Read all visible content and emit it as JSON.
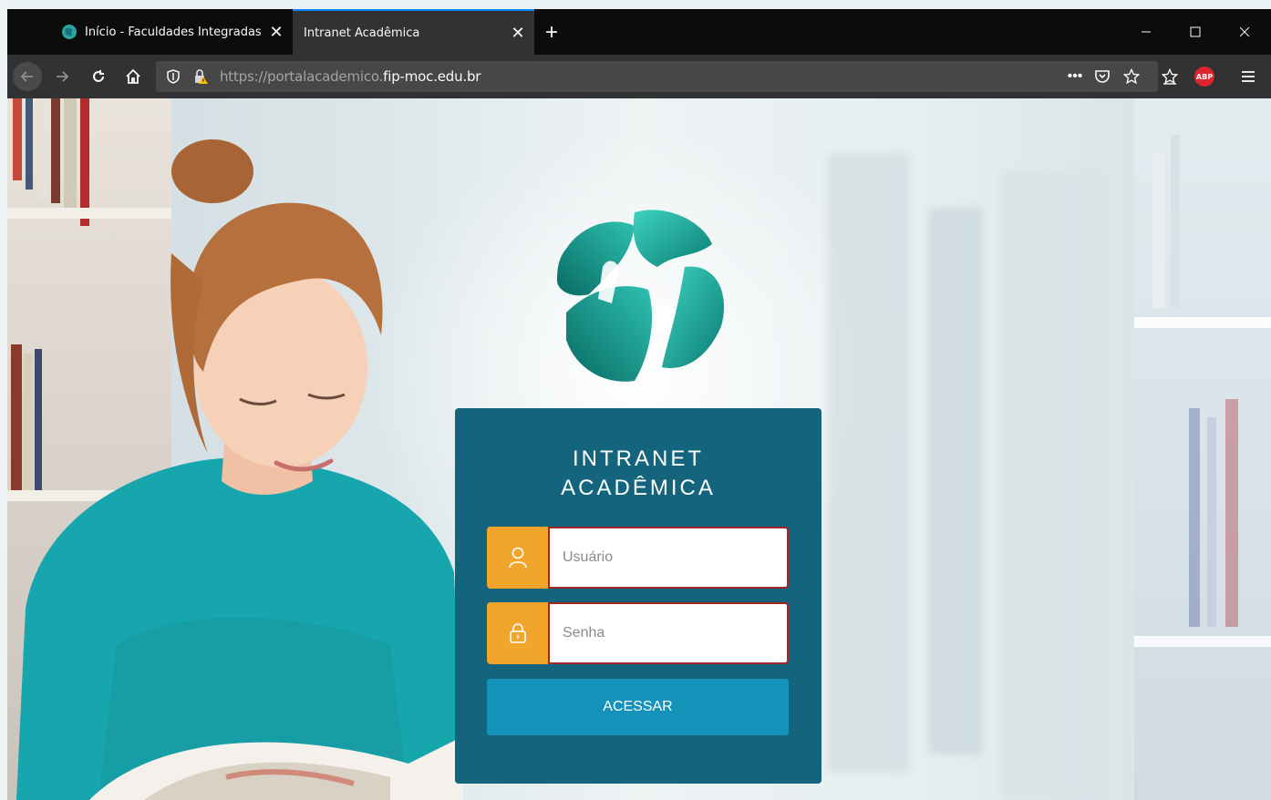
{
  "browser": {
    "tabs": [
      {
        "title": "Início - Faculdades Integradas P",
        "active": false
      },
      {
        "title": "Intranet Acadêmica",
        "active": true
      }
    ],
    "url_prefix": "https://portalacademico.",
    "url_domain": "fip-moc.edu.br",
    "abp_label": "ABP",
    "toolbar_icons": [
      "back-icon",
      "forward-icon",
      "reload-icon",
      "home-icon",
      "shield-icon",
      "lock-warning-icon",
      "more-icon",
      "pocket-icon",
      "star-icon",
      "library-icon",
      "adblock-icon",
      "menu-icon"
    ]
  },
  "login": {
    "title_line1": "INTRANET",
    "title_line2": "ACADÊMICA",
    "username_placeholder": "Usuário",
    "password_placeholder": "Senha",
    "submit_label": "ACESSAR"
  },
  "colors": {
    "card": "#13647c",
    "icon_box": "#f2a52b",
    "button": "#1592b9",
    "input_border": "#a62328",
    "logo_teal": "#1aa79a"
  }
}
